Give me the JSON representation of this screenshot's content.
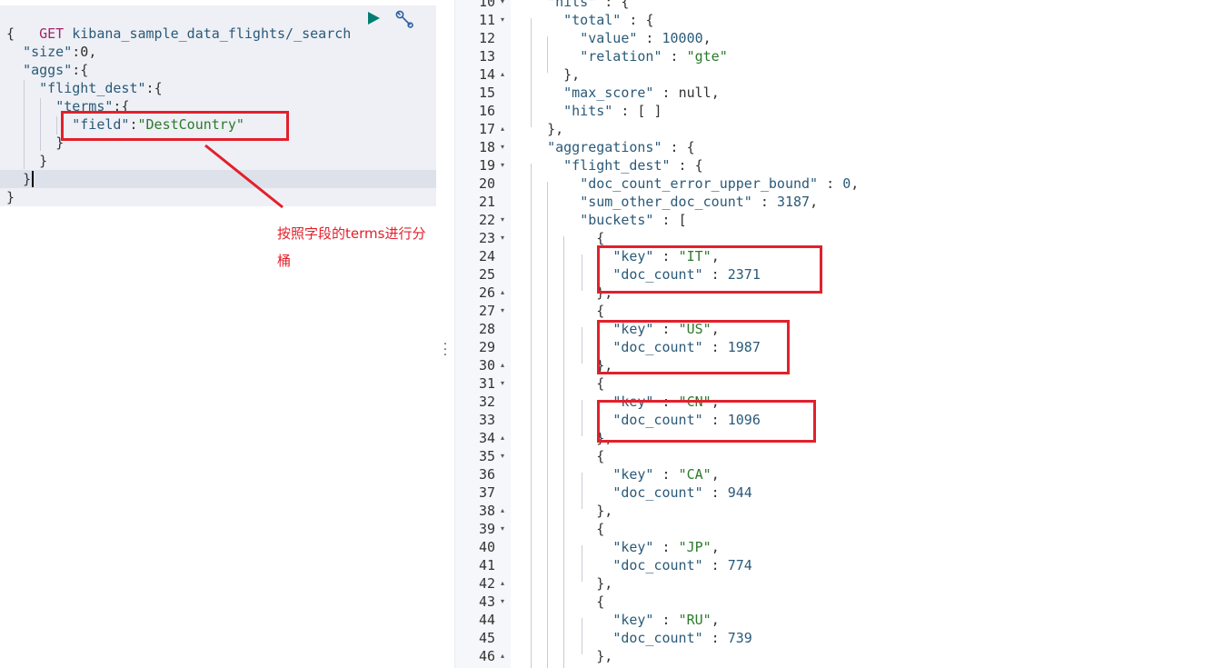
{
  "request": {
    "method": "GET",
    "path": "kibana_sample_data_flights/_search",
    "lines": [
      {
        "indent": "",
        "key": "",
        "sep": "",
        "value": "",
        "punc": "{"
      },
      {
        "indent": "  ",
        "key": "\"size\"",
        "sep": ":",
        "value": "0",
        "punc": ","
      },
      {
        "indent": "  ",
        "key": "\"aggs\"",
        "sep": ":",
        "value": "",
        "punc": "{"
      },
      {
        "indent": "    ",
        "key": "\"flight_dest\"",
        "sep": ":",
        "value": "",
        "punc": "{"
      },
      {
        "indent": "      ",
        "key": "\"terms\"",
        "sep": ":",
        "value": "",
        "punc": "{"
      },
      {
        "indent": "        ",
        "key": "\"field\"",
        "sep": ":",
        "value": "\"DestCountry\"",
        "punc": ""
      },
      {
        "indent": "      ",
        "key": "",
        "sep": "",
        "value": "",
        "punc": "}"
      },
      {
        "indent": "    ",
        "key": "",
        "sep": "",
        "value": "",
        "punc": "}"
      },
      {
        "indent": "  ",
        "key": "",
        "sep": "",
        "value": "",
        "punc": "}"
      },
      {
        "indent": "",
        "key": "",
        "sep": "",
        "value": "",
        "punc": "}"
      }
    ]
  },
  "toolbar": {
    "run_icon": "play-icon",
    "settings_icon": "wrench-icon"
  },
  "annotation": {
    "text": "按照字段的terms进行分桶",
    "color": "#e2202c"
  },
  "response": {
    "lines": [
      {
        "n": "10",
        "fold": "▾",
        "indent": "  ",
        "key": "\"hits\"",
        "sep": " : ",
        "value": "",
        "vtype": "",
        "punc": "{"
      },
      {
        "n": "11",
        "fold": "▾",
        "indent": "    ",
        "key": "\"total\"",
        "sep": " : ",
        "value": "",
        "vtype": "",
        "punc": "{"
      },
      {
        "n": "12",
        "fold": "",
        "indent": "      ",
        "key": "\"value\"",
        "sep": " : ",
        "value": "10000",
        "vtype": "num",
        "punc": ","
      },
      {
        "n": "13",
        "fold": "",
        "indent": "      ",
        "key": "\"relation\"",
        "sep": " : ",
        "value": "\"gte\"",
        "vtype": "str",
        "punc": ""
      },
      {
        "n": "14",
        "fold": "▴",
        "indent": "    ",
        "key": "",
        "sep": "",
        "value": "",
        "vtype": "",
        "punc": "},"
      },
      {
        "n": "15",
        "fold": "",
        "indent": "    ",
        "key": "\"max_score\"",
        "sep": " : ",
        "value": "null",
        "vtype": "null",
        "punc": ","
      },
      {
        "n": "16",
        "fold": "",
        "indent": "    ",
        "key": "\"hits\"",
        "sep": " : ",
        "value": "",
        "vtype": "",
        "punc": "[ ]"
      },
      {
        "n": "17",
        "fold": "▴",
        "indent": "  ",
        "key": "",
        "sep": "",
        "value": "",
        "vtype": "",
        "punc": "},"
      },
      {
        "n": "18",
        "fold": "▾",
        "indent": "  ",
        "key": "\"aggregations\"",
        "sep": " : ",
        "value": "",
        "vtype": "",
        "punc": "{"
      },
      {
        "n": "19",
        "fold": "▾",
        "indent": "    ",
        "key": "\"flight_dest\"",
        "sep": " : ",
        "value": "",
        "vtype": "",
        "punc": "{"
      },
      {
        "n": "20",
        "fold": "",
        "indent": "      ",
        "key": "\"doc_count_error_upper_bound\"",
        "sep": " : ",
        "value": "0",
        "vtype": "num",
        "punc": ","
      },
      {
        "n": "21",
        "fold": "",
        "indent": "      ",
        "key": "\"sum_other_doc_count\"",
        "sep": " : ",
        "value": "3187",
        "vtype": "num",
        "punc": ","
      },
      {
        "n": "22",
        "fold": "▾",
        "indent": "      ",
        "key": "\"buckets\"",
        "sep": " : ",
        "value": "",
        "vtype": "",
        "punc": "["
      },
      {
        "n": "23",
        "fold": "▾",
        "indent": "        ",
        "key": "",
        "sep": "",
        "value": "",
        "vtype": "",
        "punc": "{"
      },
      {
        "n": "24",
        "fold": "",
        "indent": "          ",
        "key": "\"key\"",
        "sep": " : ",
        "value": "\"IT\"",
        "vtype": "str",
        "punc": ","
      },
      {
        "n": "25",
        "fold": "",
        "indent": "          ",
        "key": "\"doc_count\"",
        "sep": " : ",
        "value": "2371",
        "vtype": "num",
        "punc": ""
      },
      {
        "n": "26",
        "fold": "▴",
        "indent": "        ",
        "key": "",
        "sep": "",
        "value": "",
        "vtype": "",
        "punc": "},"
      },
      {
        "n": "27",
        "fold": "▾",
        "indent": "        ",
        "key": "",
        "sep": "",
        "value": "",
        "vtype": "",
        "punc": "{"
      },
      {
        "n": "28",
        "fold": "",
        "indent": "          ",
        "key": "\"key\"",
        "sep": " : ",
        "value": "\"US\"",
        "vtype": "str",
        "punc": ","
      },
      {
        "n": "29",
        "fold": "",
        "indent": "          ",
        "key": "\"doc_count\"",
        "sep": " : ",
        "value": "1987",
        "vtype": "num",
        "punc": ""
      },
      {
        "n": "30",
        "fold": "▴",
        "indent": "        ",
        "key": "",
        "sep": "",
        "value": "",
        "vtype": "",
        "punc": "},"
      },
      {
        "n": "31",
        "fold": "▾",
        "indent": "        ",
        "key": "",
        "sep": "",
        "value": "",
        "vtype": "",
        "punc": "{"
      },
      {
        "n": "32",
        "fold": "",
        "indent": "          ",
        "key": "\"key\"",
        "sep": " : ",
        "value": "\"CN\"",
        "vtype": "str",
        "punc": ","
      },
      {
        "n": "33",
        "fold": "",
        "indent": "          ",
        "key": "\"doc_count\"",
        "sep": " : ",
        "value": "1096",
        "vtype": "num",
        "punc": ""
      },
      {
        "n": "34",
        "fold": "▴",
        "indent": "        ",
        "key": "",
        "sep": "",
        "value": "",
        "vtype": "",
        "punc": "},"
      },
      {
        "n": "35",
        "fold": "▾",
        "indent": "        ",
        "key": "",
        "sep": "",
        "value": "",
        "vtype": "",
        "punc": "{"
      },
      {
        "n": "36",
        "fold": "",
        "indent": "          ",
        "key": "\"key\"",
        "sep": " : ",
        "value": "\"CA\"",
        "vtype": "str",
        "punc": ","
      },
      {
        "n": "37",
        "fold": "",
        "indent": "          ",
        "key": "\"doc_count\"",
        "sep": " : ",
        "value": "944",
        "vtype": "num",
        "punc": ""
      },
      {
        "n": "38",
        "fold": "▴",
        "indent": "        ",
        "key": "",
        "sep": "",
        "value": "",
        "vtype": "",
        "punc": "},"
      },
      {
        "n": "39",
        "fold": "▾",
        "indent": "        ",
        "key": "",
        "sep": "",
        "value": "",
        "vtype": "",
        "punc": "{"
      },
      {
        "n": "40",
        "fold": "",
        "indent": "          ",
        "key": "\"key\"",
        "sep": " : ",
        "value": "\"JP\"",
        "vtype": "str",
        "punc": ","
      },
      {
        "n": "41",
        "fold": "",
        "indent": "          ",
        "key": "\"doc_count\"",
        "sep": " : ",
        "value": "774",
        "vtype": "num",
        "punc": ""
      },
      {
        "n": "42",
        "fold": "▴",
        "indent": "        ",
        "key": "",
        "sep": "",
        "value": "",
        "vtype": "",
        "punc": "},"
      },
      {
        "n": "43",
        "fold": "▾",
        "indent": "        ",
        "key": "",
        "sep": "",
        "value": "",
        "vtype": "",
        "punc": "{"
      },
      {
        "n": "44",
        "fold": "",
        "indent": "          ",
        "key": "\"key\"",
        "sep": " : ",
        "value": "\"RU\"",
        "vtype": "str",
        "punc": ","
      },
      {
        "n": "45",
        "fold": "",
        "indent": "          ",
        "key": "\"doc_count\"",
        "sep": " : ",
        "value": "739",
        "vtype": "num",
        "punc": ""
      },
      {
        "n": "46",
        "fold": "▴",
        "indent": "        ",
        "key": "",
        "sep": "",
        "value": "",
        "vtype": "",
        "punc": "},"
      }
    ]
  }
}
